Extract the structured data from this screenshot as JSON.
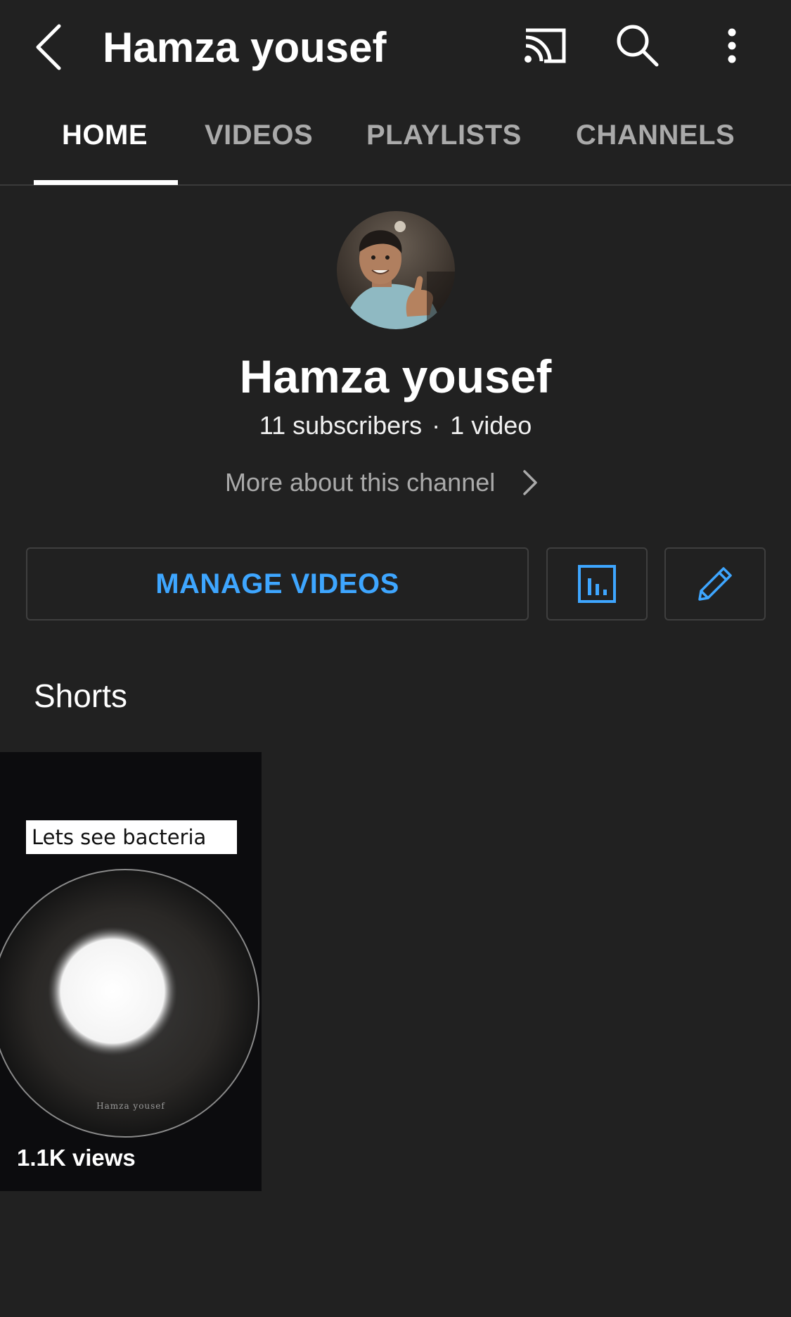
{
  "appbar": {
    "title": "Hamza yousef",
    "icons": [
      "back-arrow-icon",
      "cast-icon",
      "search-icon",
      "more-vert-icon"
    ]
  },
  "tabs": [
    {
      "label": "HOME",
      "active": true
    },
    {
      "label": "VIDEOS",
      "active": false
    },
    {
      "label": "PLAYLISTS",
      "active": false
    },
    {
      "label": "CHANNELS",
      "active": false
    }
  ],
  "channel": {
    "name": "Hamza yousef",
    "subscribers": "11 subscribers",
    "separator": "·",
    "videos": "1 video",
    "more_about": "More about this channel"
  },
  "actions": {
    "manage_videos": "MANAGE VIDEOS",
    "analytics_icon": "analytics-icon",
    "edit_icon": "edit-pencil-icon"
  },
  "shorts": {
    "section_title": "Shorts",
    "items": [
      {
        "caption": "Lets see bacteria",
        "watermark": "Hamza yousef",
        "views": "1.1K views"
      }
    ]
  },
  "colors": {
    "background": "#212121",
    "accent_blue": "#3ea6ff",
    "text_primary": "#ffffff",
    "text_secondary": "#aaaaaa"
  }
}
